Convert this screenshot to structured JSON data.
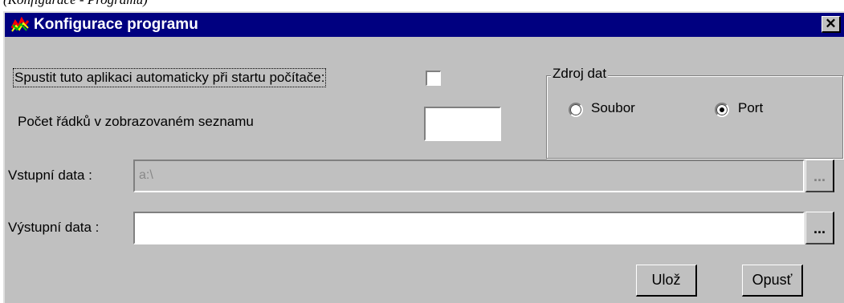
{
  "caption": "(Konfigurace - Programu)",
  "window": {
    "title": "Konfigurace programu",
    "close_glyph": "✕"
  },
  "settings": {
    "autostart_label": "Spustit tuto aplikaci automaticky  při startu počítače:",
    "autostart_checked": false,
    "rows_label": "Počet řádků v zobrazovaném seznamu",
    "rows_value": ""
  },
  "data_source": {
    "legend": "Zdroj dat",
    "options": [
      {
        "label": "Soubor",
        "selected": false
      },
      {
        "label": "Port",
        "selected": true
      }
    ]
  },
  "input_data": {
    "label": "Vstupní data :",
    "value": "a:\\",
    "enabled": false,
    "browse_label": "..."
  },
  "output_data": {
    "label": "Výstupní data :",
    "value": "",
    "enabled": true,
    "browse_label": "..."
  },
  "buttons": {
    "save": "Ulož",
    "exit": "Opusť"
  },
  "icons": {
    "app": "app-icon",
    "close": "close-icon"
  }
}
